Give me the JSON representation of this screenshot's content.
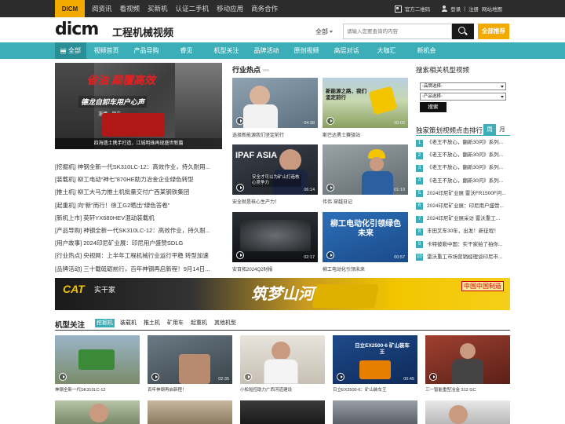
{
  "topbar": {
    "brand": "DICM",
    "nav": [
      "阅资讯",
      "看视频",
      "买新机",
      "认证二手机",
      "移动应用",
      "商务合作"
    ],
    "qr": "官方二维码",
    "login": "登录",
    "register": "注册",
    "sitemap": "网站地图"
  },
  "header": {
    "logo": "dicm",
    "slogan": "工程机械视频",
    "search_scope": "全部",
    "search_placeholder": "请输入您要查询的内容",
    "join": "全部推荐"
  },
  "mainnav": [
    "全部",
    "视频首页",
    "产品导购",
    "睿见",
    "机型关注",
    "品牌活动",
    "原创视频",
    "高层对话",
    "大咖汇",
    "新机会"
  ],
  "hero": {
    "headline": "省油 颠覆高效",
    "sub": "德龙自卸车用户心声",
    "location": "淄博 · 周庄",
    "caption": "四海遗土携手打造，江城明珠再现盛世新篇"
  },
  "news": [
    "[挖掘机] 神钢全新一代SK310LC-12：高效作业，持久耐用...",
    "[装载机] 柳工电动“神七”870HE助力冶金企业绿色转型",
    "[推土机] 柳工大马力推土机批量交付广西某钢铁集团",
    "[起重机] 向“新”而行！徐工G2晒出“绿色答卷”",
    "[新机上市] 英轩YX680HEV混动装载机",
    "[产品导购] 神钢全新一代SK310LC-12：高效作业，持久耐...",
    "[用户故事] 2024印尼矿业展：印尼用户盛赞SDLG",
    "[行业热点] 央视网：上半年工程机械行业运行平稳 转型加速",
    "[品牌活动] 三十载砥砺前行，百年神钢再启新程！9月14日..."
  ],
  "hot": {
    "title": "行业热点",
    "cards": [
      {
        "caption": "选择新能源我们坚定前行",
        "duration": "04:38"
      },
      {
        "caption": "斯巴达勇士赛驿站",
        "duration": "00:02"
      },
      {
        "caption": "安全就是核心生产力！",
        "duration": "06:14"
      },
      {
        "caption": "伟伟·穿越日记",
        "duration": "01:19"
      },
      {
        "caption": "安百拓2024Q2财报",
        "duration": "02:17"
      },
      {
        "caption": "柳工电动化引领未来",
        "duration": "00:57"
      }
    ],
    "overlays": [
      "新能源之路，我们坚定前行",
      "安全才可以为矿山打造核心竞争力",
      "柳工电动化引领绿色未来"
    ]
  },
  "right": {
    "search_title": "搜索相关机型视频",
    "brand_select": "-品牌选择-",
    "type_select": "-产品选择-",
    "search_btn": "搜索",
    "rank_title": "独家策划视频点击排行",
    "tab_week": "周",
    "tab_month": "月",
    "rank": [
      "《老王不放心，翻新30问》系列...",
      "《老王不放心，翻新30问》系列...",
      "《老王不放心，翻新30问》系列...",
      "《老王不放心，翻新30问》系列...",
      "2024印尼矿业展 雷沃FR1500F问...",
      "2024印尼矿业展：印尼用户盛赞...",
      "2024印尼矿业展采访 雷沃重工...",
      "丰田叉车30年，出发！新征程！",
      "卡特彼勒中国：实干家拍了拍你...",
      "雷沃重工市场营销经理谈印尼市..."
    ]
  },
  "banner": {
    "brand": "CAT",
    "slogan": "实干家",
    "big": "筑梦山河",
    "made": "中国中国制造"
  },
  "models": {
    "title": "机型关注",
    "tabs": [
      "挖掘机",
      "装载机",
      "推土机",
      "矿用车",
      "起重机",
      "其他机型"
    ],
    "cards": [
      {
        "caption": "神钢全新一代SK310LC-12",
        "duration": ""
      },
      {
        "caption": "百年神钢再启新程！",
        "duration": "02:35"
      },
      {
        "caption": "小松船控助力广西河道建设",
        "duration": ""
      },
      {
        "caption": "日立EX2500-6：矿山装车王",
        "duration": "00:45"
      },
      {
        "caption": "三一智能重型冶金 312 GC",
        "duration": ""
      }
    ],
    "overlay": "日立EX2500-6 矿山装车王"
  }
}
